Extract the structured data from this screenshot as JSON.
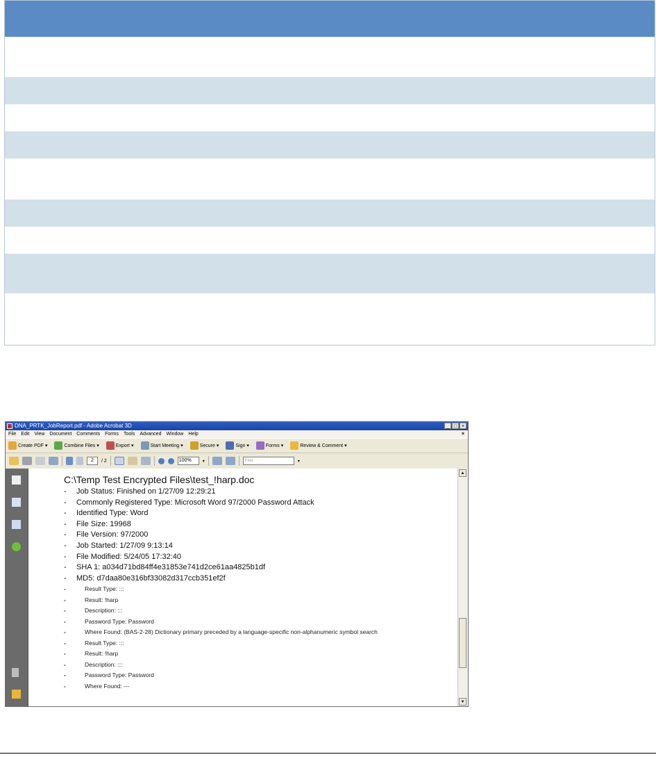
{
  "window": {
    "title": "DNA_PRTK_JobReport.pdf - Adobe Acrobat 3D",
    "menu": [
      "File",
      "Edit",
      "View",
      "Document",
      "Comments",
      "Forms",
      "Tools",
      "Advanced",
      "Window",
      "Help"
    ],
    "toolbar": {
      "create_pdf": "Create PDF",
      "combine_files": "Combine Files",
      "export": "Export",
      "start_meeting": "Start Meeting",
      "secure": "Secure",
      "sign": "Sign",
      "forms": "Forms",
      "review_comment": "Review & Comment"
    },
    "nav": {
      "page_current": "2",
      "page_total": "/ 2",
      "zoom": "100%",
      "find_placeholder": "Find"
    }
  },
  "report": {
    "title": "C:\\Temp Test Encrypted Files\\test_!harp.doc",
    "details": [
      "Job Status: Finished on 1/27/09 12:29:21",
      "Commonly Registered Type: Microsoft Word 97/2000 Password Attack",
      "Identified Type: Word",
      "File Size: 19968",
      "File Version: 97/2000",
      "Job Started: 1/27/09 9:13:14",
      "File Modified: 5/24/05 17:32:40",
      "SHA 1: a034d71bd84ff4e31853e741d2ce61aa4825b1df",
      "MD5: d7daa80e316bf33082d317ccb351ef2f"
    ],
    "results": [
      "Result Type: :::",
      "Result: !harp",
      "Description: :::",
      "Password Type: Password",
      "Where Found: (BAS-2-28) Dictionary primary preceded by a language-specific non-alphanumeric symbol search",
      "Result Type: :::",
      "Result: !harp",
      "Description: :::",
      "Password Type: Password",
      "Where Found: ---"
    ]
  }
}
